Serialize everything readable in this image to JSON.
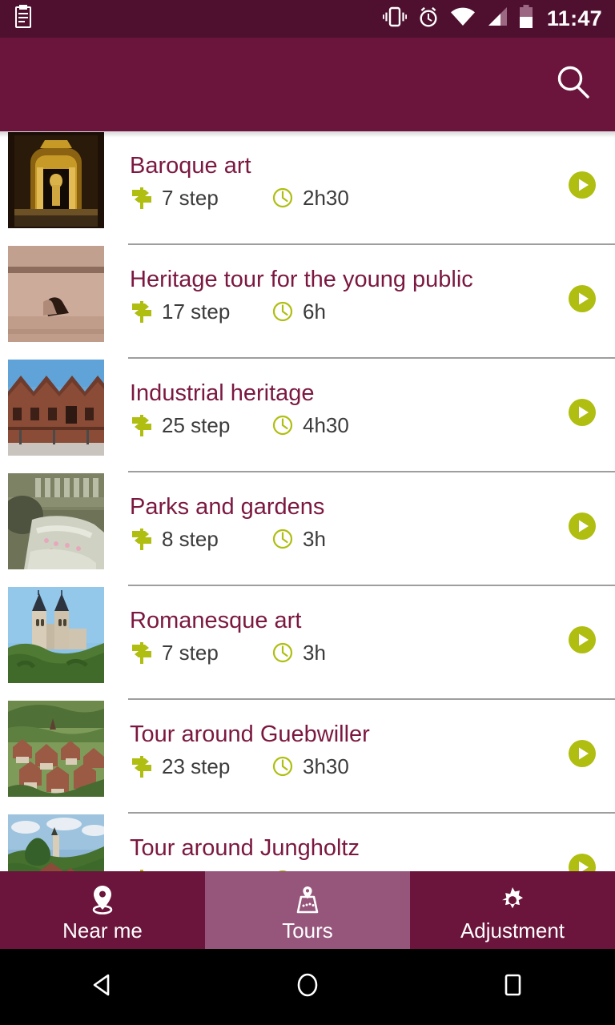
{
  "statusbar": {
    "background": "#4F1030",
    "time": "11:47",
    "icons": [
      "clipboard-icon",
      "vibrate-icon",
      "alarm-icon",
      "wifi-icon",
      "signal-icon",
      "battery-icon"
    ]
  },
  "appbar": {
    "background": "#6B143C",
    "title": "",
    "search_label": "search-icon"
  },
  "theme": {
    "brand": "#6B143C",
    "brand_dark": "#4F1030",
    "brand_light": "#96557B",
    "title_color": "#7B1840",
    "accent_green": "#AFBE10",
    "divider": "#9e9e9e"
  },
  "list": {
    "items": [
      {
        "title": "Baroque art",
        "steps": "7 step",
        "duration": "2h30",
        "thumb": "baroque-altar-thumbnail"
      },
      {
        "title": "Heritage tour for the young public",
        "steps": "17 step",
        "duration": "6h",
        "thumb": "stone-carving-thumbnail"
      },
      {
        "title": "Industrial heritage",
        "steps": "25 step",
        "duration": "4h30",
        "thumb": "brick-factory-thumbnail"
      },
      {
        "title": "Parks and gardens",
        "steps": "8 step",
        "duration": "3h",
        "thumb": "garden-fountain-thumbnail"
      },
      {
        "title": "Romanesque art",
        "steps": "7 step",
        "duration": "3h",
        "thumb": "romanesque-church-thumbnail"
      },
      {
        "title": "Tour around Guebwiller",
        "steps": "23 step",
        "duration": "3h30",
        "thumb": "guebwiller-village-thumbnail"
      },
      {
        "title": "Tour around Jungholtz",
        "steps": "",
        "duration": "",
        "thumb": "jungholtz-church-thumbnail"
      }
    ]
  },
  "tabbar": {
    "tabs": [
      {
        "label": "Near me",
        "icon": "location-pin-icon",
        "active": false
      },
      {
        "label": "Tours",
        "icon": "map-route-icon",
        "active": true
      },
      {
        "label": "Adjustment",
        "icon": "gear-icon",
        "active": false
      }
    ]
  },
  "navbar": {
    "back": "back-triangle-icon",
    "home": "home-circle-icon",
    "recents": "recents-square-icon"
  }
}
